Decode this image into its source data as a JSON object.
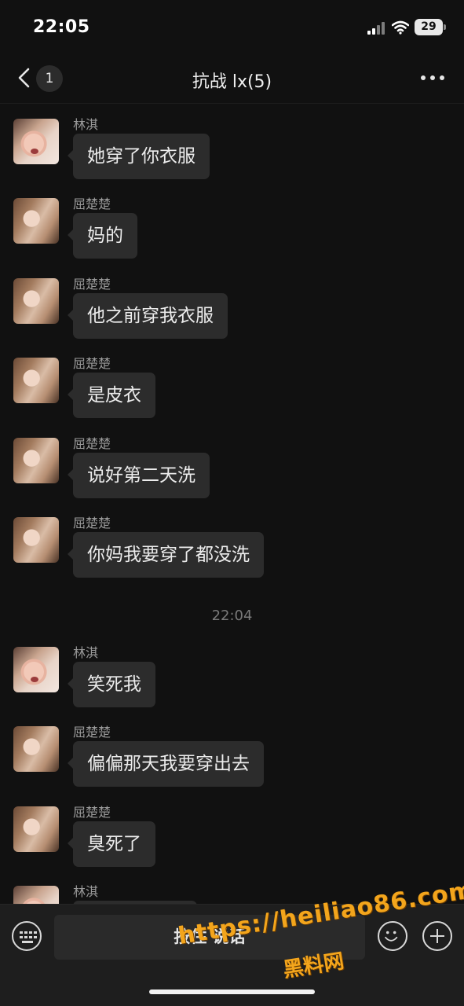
{
  "status_bar": {
    "time": "22:05",
    "battery": "29"
  },
  "nav": {
    "unread_count": "1",
    "title": "抗战 lx(5)"
  },
  "messages": [
    {
      "sender": "林淇",
      "text": "她穿了你衣服",
      "avatar": "lin"
    },
    {
      "sender": "屈楚楚",
      "text": "妈的",
      "avatar": "qu"
    },
    {
      "sender": "屈楚楚",
      "text": "他之前穿我衣服",
      "avatar": "qu"
    },
    {
      "sender": "屈楚楚",
      "text": "是皮衣",
      "avatar": "qu"
    },
    {
      "sender": "屈楚楚",
      "text": "说好第二天洗",
      "avatar": "qu"
    },
    {
      "sender": "屈楚楚",
      "text": "你妈我要穿了都没洗",
      "avatar": "qu"
    },
    {
      "sender": "林淇",
      "text": "笑死我",
      "avatar": "lin"
    },
    {
      "sender": "屈楚楚",
      "text": "偏偏那天我要穿出去",
      "avatar": "qu"
    },
    {
      "sender": "屈楚楚",
      "text": "臭死了",
      "avatar": "qu"
    },
    {
      "sender": "林淇",
      "text": "",
      "avatar": "lin"
    }
  ],
  "timestamp": "22:04",
  "input": {
    "voice_label": "按住 说话"
  },
  "watermark": {
    "url": "https://heiliao86.com",
    "name": "黑料网"
  },
  "colors": {
    "background": "#111111",
    "bubble": "#2c2c2c",
    "watermark": "#f3a51c"
  }
}
